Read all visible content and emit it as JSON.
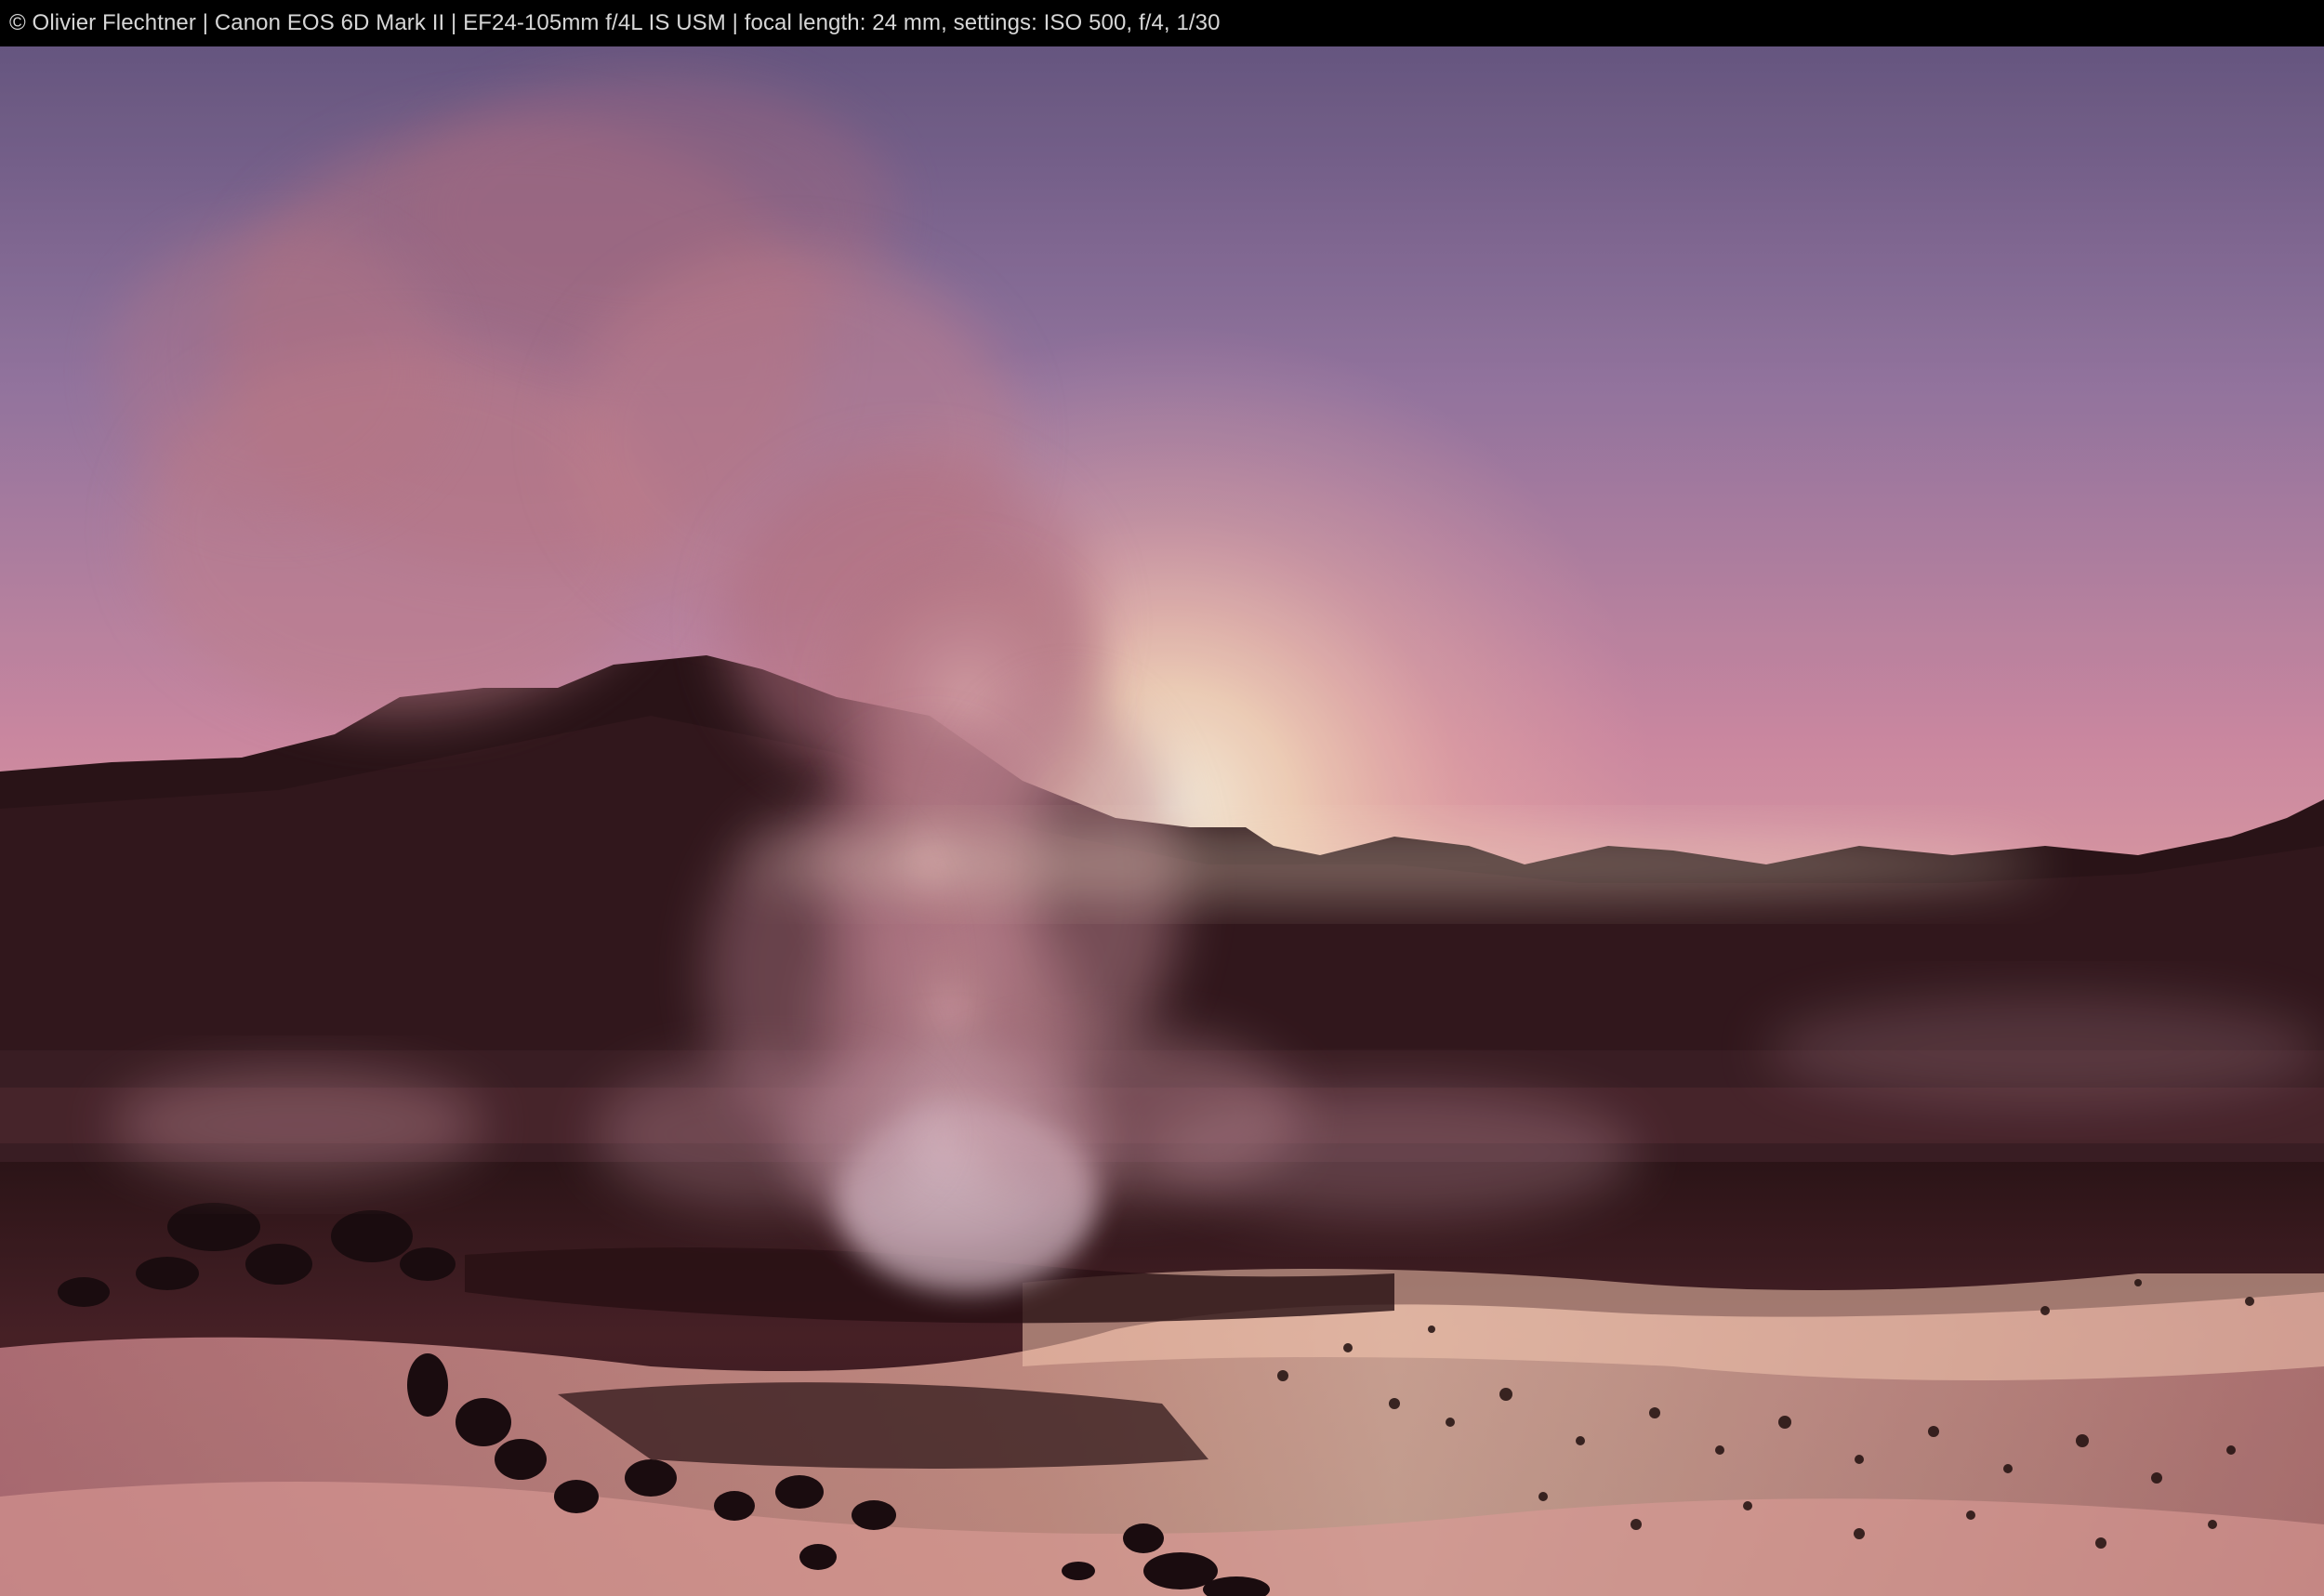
{
  "caption": {
    "text": "© Olivier Flechtner | Canon EOS 6D Mark II | EF24-105mm f/4L IS USM | focal length: 24 mm, settings: ISO 500, f/4, 1/30"
  },
  "photo": {
    "subject": "geyser-steam-at-sunrise",
    "colors": {
      "sky_top": "#6f5b86",
      "sky_mid": "#c97fa0",
      "sky_horizon": "#ffd7b5",
      "sun_glow": "#fff0d8",
      "mountain": "#2a1418",
      "ground": "#3a1c22",
      "water_reflection": "#f3b6a8",
      "steam": "#c98a95"
    }
  }
}
